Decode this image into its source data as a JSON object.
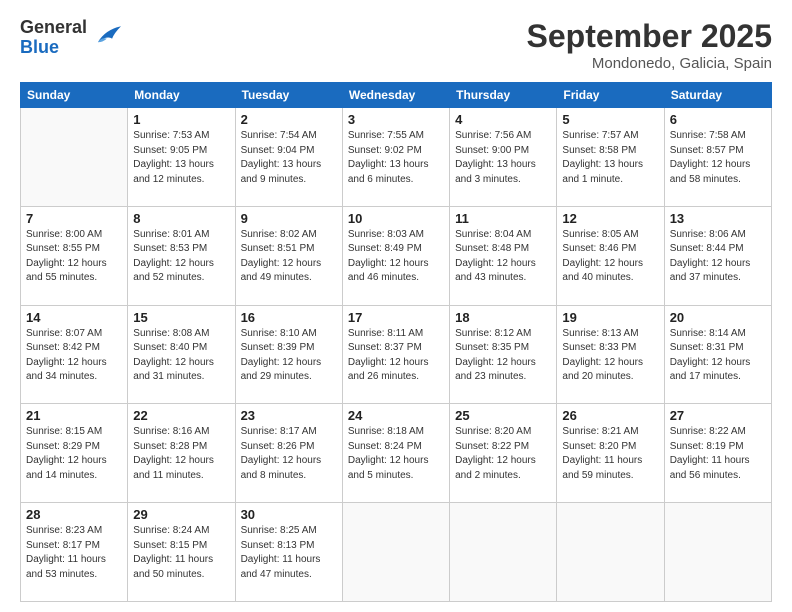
{
  "logo": {
    "general": "General",
    "blue": "Blue"
  },
  "title": "September 2025",
  "location": "Mondonedo, Galicia, Spain",
  "days_of_week": [
    "Sunday",
    "Monday",
    "Tuesday",
    "Wednesday",
    "Thursday",
    "Friday",
    "Saturday"
  ],
  "weeks": [
    [
      {
        "day": "",
        "info": ""
      },
      {
        "day": "1",
        "info": "Sunrise: 7:53 AM\nSunset: 9:05 PM\nDaylight: 13 hours\nand 12 minutes."
      },
      {
        "day": "2",
        "info": "Sunrise: 7:54 AM\nSunset: 9:04 PM\nDaylight: 13 hours\nand 9 minutes."
      },
      {
        "day": "3",
        "info": "Sunrise: 7:55 AM\nSunset: 9:02 PM\nDaylight: 13 hours\nand 6 minutes."
      },
      {
        "day": "4",
        "info": "Sunrise: 7:56 AM\nSunset: 9:00 PM\nDaylight: 13 hours\nand 3 minutes."
      },
      {
        "day": "5",
        "info": "Sunrise: 7:57 AM\nSunset: 8:58 PM\nDaylight: 13 hours\nand 1 minute."
      },
      {
        "day": "6",
        "info": "Sunrise: 7:58 AM\nSunset: 8:57 PM\nDaylight: 12 hours\nand 58 minutes."
      }
    ],
    [
      {
        "day": "7",
        "info": "Sunrise: 8:00 AM\nSunset: 8:55 PM\nDaylight: 12 hours\nand 55 minutes."
      },
      {
        "day": "8",
        "info": "Sunrise: 8:01 AM\nSunset: 8:53 PM\nDaylight: 12 hours\nand 52 minutes."
      },
      {
        "day": "9",
        "info": "Sunrise: 8:02 AM\nSunset: 8:51 PM\nDaylight: 12 hours\nand 49 minutes."
      },
      {
        "day": "10",
        "info": "Sunrise: 8:03 AM\nSunset: 8:49 PM\nDaylight: 12 hours\nand 46 minutes."
      },
      {
        "day": "11",
        "info": "Sunrise: 8:04 AM\nSunset: 8:48 PM\nDaylight: 12 hours\nand 43 minutes."
      },
      {
        "day": "12",
        "info": "Sunrise: 8:05 AM\nSunset: 8:46 PM\nDaylight: 12 hours\nand 40 minutes."
      },
      {
        "day": "13",
        "info": "Sunrise: 8:06 AM\nSunset: 8:44 PM\nDaylight: 12 hours\nand 37 minutes."
      }
    ],
    [
      {
        "day": "14",
        "info": "Sunrise: 8:07 AM\nSunset: 8:42 PM\nDaylight: 12 hours\nand 34 minutes."
      },
      {
        "day": "15",
        "info": "Sunrise: 8:08 AM\nSunset: 8:40 PM\nDaylight: 12 hours\nand 31 minutes."
      },
      {
        "day": "16",
        "info": "Sunrise: 8:10 AM\nSunset: 8:39 PM\nDaylight: 12 hours\nand 29 minutes."
      },
      {
        "day": "17",
        "info": "Sunrise: 8:11 AM\nSunset: 8:37 PM\nDaylight: 12 hours\nand 26 minutes."
      },
      {
        "day": "18",
        "info": "Sunrise: 8:12 AM\nSunset: 8:35 PM\nDaylight: 12 hours\nand 23 minutes."
      },
      {
        "day": "19",
        "info": "Sunrise: 8:13 AM\nSunset: 8:33 PM\nDaylight: 12 hours\nand 20 minutes."
      },
      {
        "day": "20",
        "info": "Sunrise: 8:14 AM\nSunset: 8:31 PM\nDaylight: 12 hours\nand 17 minutes."
      }
    ],
    [
      {
        "day": "21",
        "info": "Sunrise: 8:15 AM\nSunset: 8:29 PM\nDaylight: 12 hours\nand 14 minutes."
      },
      {
        "day": "22",
        "info": "Sunrise: 8:16 AM\nSunset: 8:28 PM\nDaylight: 12 hours\nand 11 minutes."
      },
      {
        "day": "23",
        "info": "Sunrise: 8:17 AM\nSunset: 8:26 PM\nDaylight: 12 hours\nand 8 minutes."
      },
      {
        "day": "24",
        "info": "Sunrise: 8:18 AM\nSunset: 8:24 PM\nDaylight: 12 hours\nand 5 minutes."
      },
      {
        "day": "25",
        "info": "Sunrise: 8:20 AM\nSunset: 8:22 PM\nDaylight: 12 hours\nand 2 minutes."
      },
      {
        "day": "26",
        "info": "Sunrise: 8:21 AM\nSunset: 8:20 PM\nDaylight: 11 hours\nand 59 minutes."
      },
      {
        "day": "27",
        "info": "Sunrise: 8:22 AM\nSunset: 8:19 PM\nDaylight: 11 hours\nand 56 minutes."
      }
    ],
    [
      {
        "day": "28",
        "info": "Sunrise: 8:23 AM\nSunset: 8:17 PM\nDaylight: 11 hours\nand 53 minutes."
      },
      {
        "day": "29",
        "info": "Sunrise: 8:24 AM\nSunset: 8:15 PM\nDaylight: 11 hours\nand 50 minutes."
      },
      {
        "day": "30",
        "info": "Sunrise: 8:25 AM\nSunset: 8:13 PM\nDaylight: 11 hours\nand 47 minutes."
      },
      {
        "day": "",
        "info": ""
      },
      {
        "day": "",
        "info": ""
      },
      {
        "day": "",
        "info": ""
      },
      {
        "day": "",
        "info": ""
      }
    ]
  ]
}
